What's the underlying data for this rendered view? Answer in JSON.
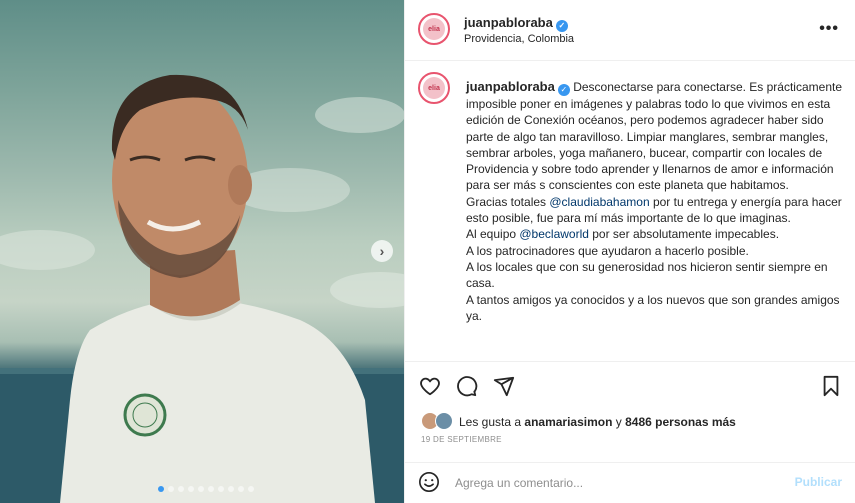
{
  "post": {
    "username": "juanpabloraba",
    "location": "Providencia, Colombia",
    "more_icon": "more-horizontal-icon",
    "avatar_text": "elia",
    "carousel": {
      "total_slides": 10,
      "active_slide": 1
    }
  },
  "caption": {
    "lines": [
      "Desconectarse para conectarse. Es prácticamente imposible poner en imágenes y palabras todo lo que vivimos en esta edición de Conexión océanos, pero podemos agradecer haber sido parte de algo tan maravilloso. Limpiar manglares, sembrar mangles, sembrar arboles, yoga mañanero, bucear, compartir con locales de Providencia y sobre todo aprender y llenarnos de amor e información para ser más s conscientes con este planeta que habitamos."
    ],
    "thanks_prefix": "Gracias totales ",
    "thanks_mention": "@claudiabahamon",
    "thanks_suffix": " por tu entrega y energía para hacer esto posible, fue para mí más importante de lo que imaginas.",
    "team_prefix": "Al equipo ",
    "team_mention": "@beclaworld",
    "team_suffix": " por ser absolutamente impecables.",
    "sponsors": "A los patrocinadores que ayudaron a hacerlo posible.",
    "locals": "A los locales que con su generosidad nos hicieron sentir siempre en casa.",
    "friends": "A tantos amigos ya conocidos y a los nuevos que son grandes amigos ya."
  },
  "likes": {
    "prefix": "Les gusta a ",
    "first_user": "anamariasimon",
    "middle": " y ",
    "count_text": "8486 personas más"
  },
  "date": "19 DE SEPTIEMBRE",
  "comment": {
    "placeholder": "Agrega un comentario...",
    "publish_label": "Publicar"
  },
  "icons": {
    "like": "heart-icon",
    "comment": "comment-icon",
    "share": "share-icon",
    "save": "bookmark-icon",
    "emoji": "emoji-icon",
    "next": "chevron-right-icon"
  },
  "colors": {
    "link": "#00376b",
    "verified": "#3897f0",
    "publish_disabled": "#b2dffc",
    "muted": "#8e8e8e"
  }
}
